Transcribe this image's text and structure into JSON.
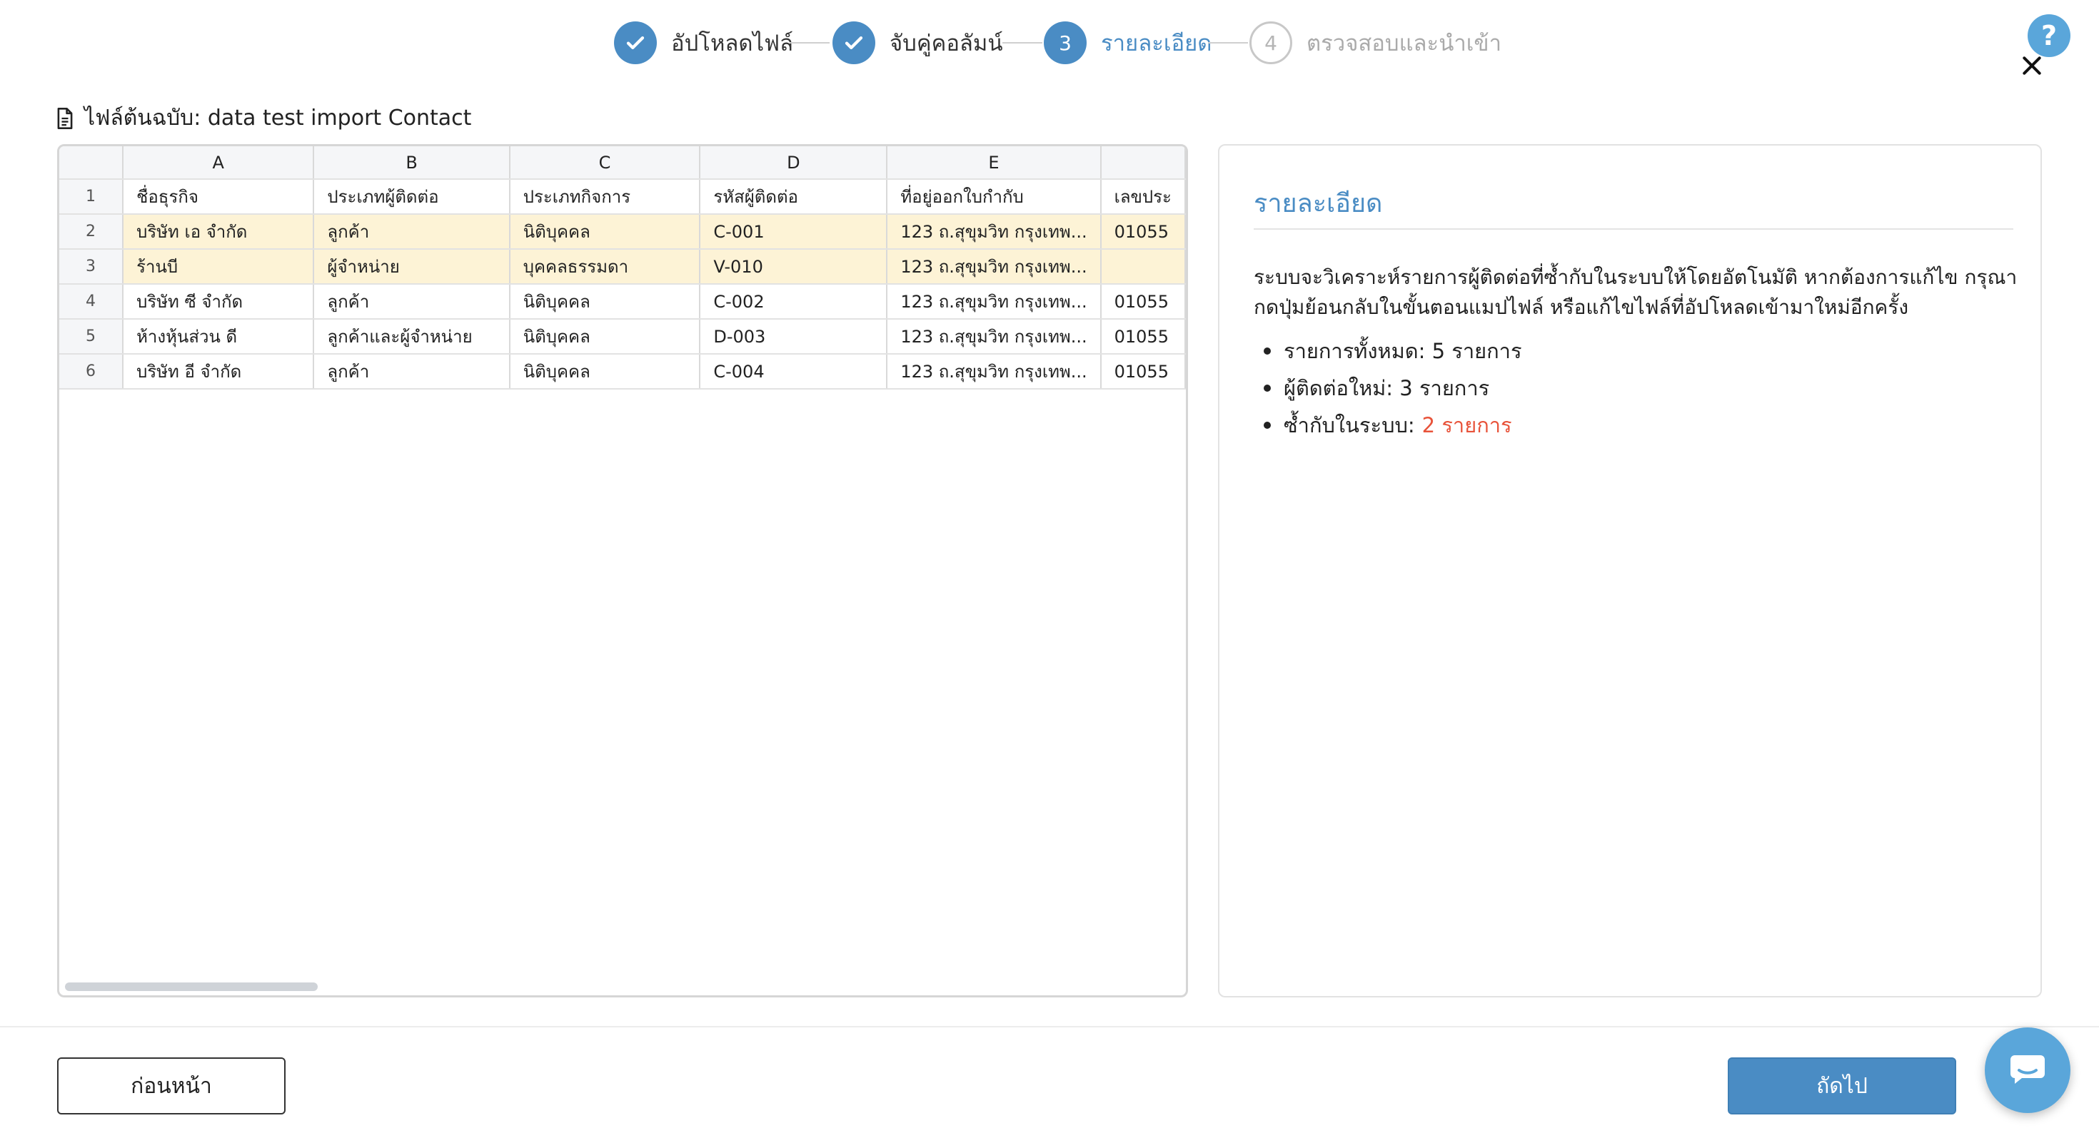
{
  "stepper": {
    "steps": [
      {
        "number": "1",
        "label": "อัปโหลดไฟล์",
        "state": "done"
      },
      {
        "number": "2",
        "label": "จับคู่คอลัมน์",
        "state": "done"
      },
      {
        "number": "3",
        "label": "รายละเอียด",
        "state": "active"
      },
      {
        "number": "4",
        "label": "ตรวจสอบและนำเข้า",
        "state": "pending"
      }
    ]
  },
  "help": {
    "label": "?"
  },
  "file": {
    "title": "ไฟล์ต้นฉบับ: data test import Contact"
  },
  "sheet": {
    "columns": [
      "A",
      "B",
      "C",
      "D",
      "E",
      ""
    ],
    "rows": [
      {
        "num": "1",
        "dup": false,
        "cells": [
          "ชื่อธุรกิจ",
          "ประเภทผู้ติดต่อ",
          "ประเภทกิจการ",
          "รหัสผู้ติดต่อ",
          "ที่อยู่ออกใบกำกับ",
          "เลขประ"
        ]
      },
      {
        "num": "2",
        "dup": true,
        "cells": [
          "บริษัท เอ จำกัด",
          "ลูกค้า",
          "นิติบุคคล",
          "C-001",
          "123 ถ.สุขุมวิท กรุงเทพ...",
          "01055"
        ]
      },
      {
        "num": "3",
        "dup": true,
        "cells": [
          "ร้านบี",
          "ผู้จำหน่าย",
          "บุคคลธรรมดา",
          "V-010",
          "123 ถ.สุขุมวิท กรุงเทพ...",
          ""
        ]
      },
      {
        "num": "4",
        "dup": false,
        "cells": [
          "บริษัท ซี จำกัด",
          "ลูกค้า",
          "นิติบุคคล",
          "C-002",
          "123 ถ.สุขุมวิท กรุงเทพ...",
          "01055"
        ]
      },
      {
        "num": "5",
        "dup": false,
        "cells": [
          "ห้างหุ้นส่วน ดี",
          "ลูกค้าและผู้จำหน่าย",
          "นิติบุคคล",
          "D-003",
          "123 ถ.สุขุมวิท กรุงเทพ...",
          "01055"
        ]
      },
      {
        "num": "6",
        "dup": false,
        "cells": [
          "บริษัท อี จำกัด",
          "ลูกค้า",
          "นิติบุคคล",
          "C-004",
          "123 ถ.สุขุมวิท กรุงเทพ...",
          "01055"
        ]
      }
    ]
  },
  "detail": {
    "title": "รายละเอียด",
    "description": "ระบบจะวิเคราะห์รายการผู้ติดต่อที่ซ้ำกับในระบบให้โดยอัตโนมัติ หากต้องการแก้ไข กรุณากดปุ่มย้อนกลับในขั้นตอนแมปไฟล์ หรือแก้ไขไฟล์ที่อัปโหลดเข้ามาใหม่อีกครั้ง",
    "stats": {
      "total_label": "รายการทั้งหมด: 5 รายการ",
      "new_label": "ผู้ติดต่อใหม่: 3 รายการ",
      "dup_label": "ซ้ำกับในระบบ:",
      "dup_value": "2 รายการ"
    }
  },
  "footer": {
    "back_label": "ก่อนหน้า",
    "next_label": "ถัดไป"
  },
  "colors": {
    "accent": "#4a8cc4",
    "duplicate_row": "#fdf3d6",
    "duplicate_text": "#e8533a"
  }
}
